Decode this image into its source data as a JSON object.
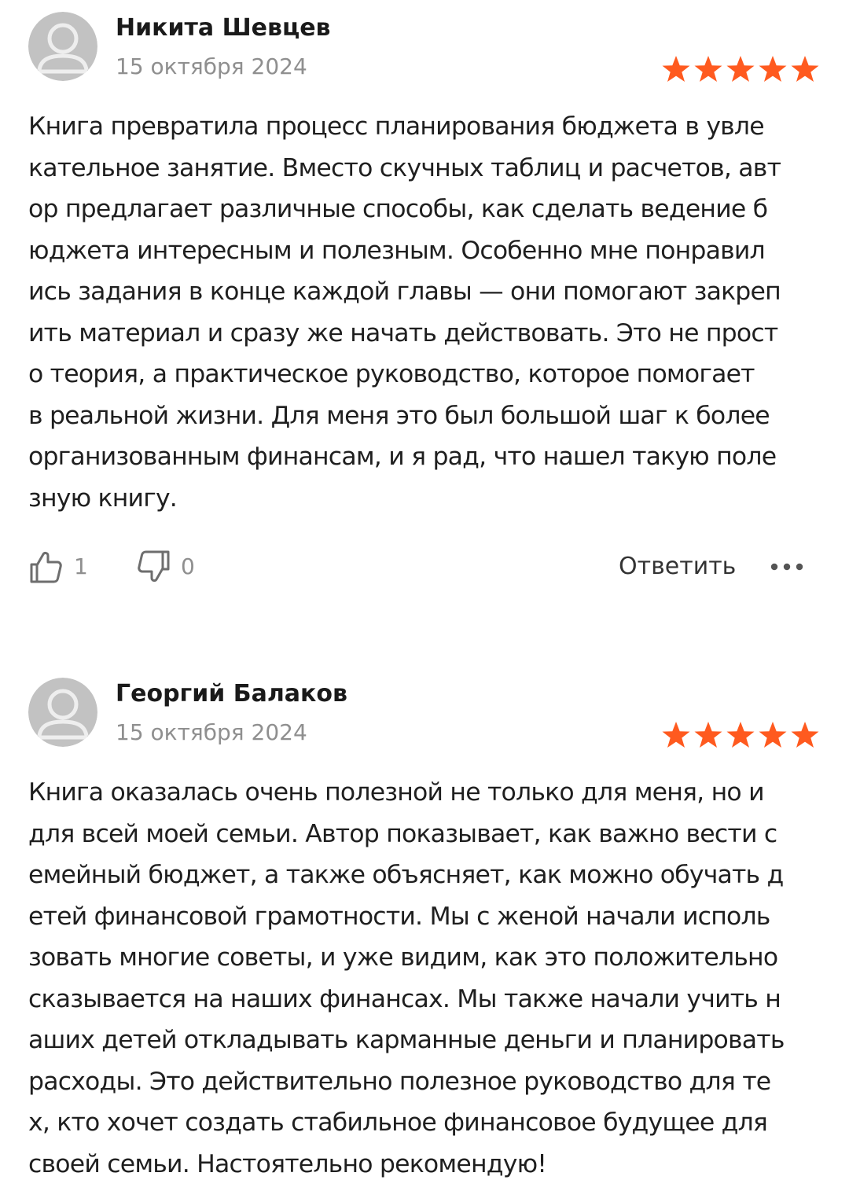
{
  "colors": {
    "star": "#ff5a1f",
    "avatar_bg": "#c2c2c2",
    "avatar_fg": "#eeeeee",
    "muted_text": "#8f8f8f",
    "icon": "#6e6e6e"
  },
  "reviews": [
    {
      "author": "Никита Шевцев",
      "date": "15 октября 2024",
      "rating": 5,
      "text": "Книга превратила процесс планирования бюджета в увле\nкательное занятие. Вместо скучных таблиц и расчетов, авт\nор предлагает различные способы, как сделать ведение б\nюджета интересным и полезным. Особенно мне понравил\nись задания в конце каждой главы — они помогают закреп\nить материал и сразу же начать действовать. Это не прост\nо теория, а практическое руководство, которое помогает\nв реальной жизни. Для меня это был большой шаг к более\nорганизованным финансам, и я рад, что нашел такую поле\nзную книгу.",
      "likes": "1",
      "dislikes": "0",
      "reply_label": "Ответить",
      "avatar_icon": "user-avatar-icon",
      "like_icon": "thumbs-up-icon",
      "dislike_icon": "thumbs-down-icon",
      "more_icon": "more-dots-icon"
    },
    {
      "author": "Георгий Балаков",
      "date": "15 октября 2024",
      "rating": 5,
      "text": "Книга оказалась очень полезной не только для меня, но и\nдля всей моей семьи. Автор показывает, как важно вести с\nемейный бюджет, а также объясняет, как можно обучать д\nетей финансовой грамотности. Мы с женой начали исполь\nзовать многие советы, и уже видим, как это положительно\nсказывается на наших финансах. Мы также начали учить н\nаших детей откладывать карманные деньги и планировать\nрасходы. Это действительно полезное руководство для те\nх, кто хочет создать стабильное финансовое будущее для\nсвоей семьи. Настоятельно рекомендую!",
      "avatar_icon": "user-avatar-icon"
    }
  ]
}
